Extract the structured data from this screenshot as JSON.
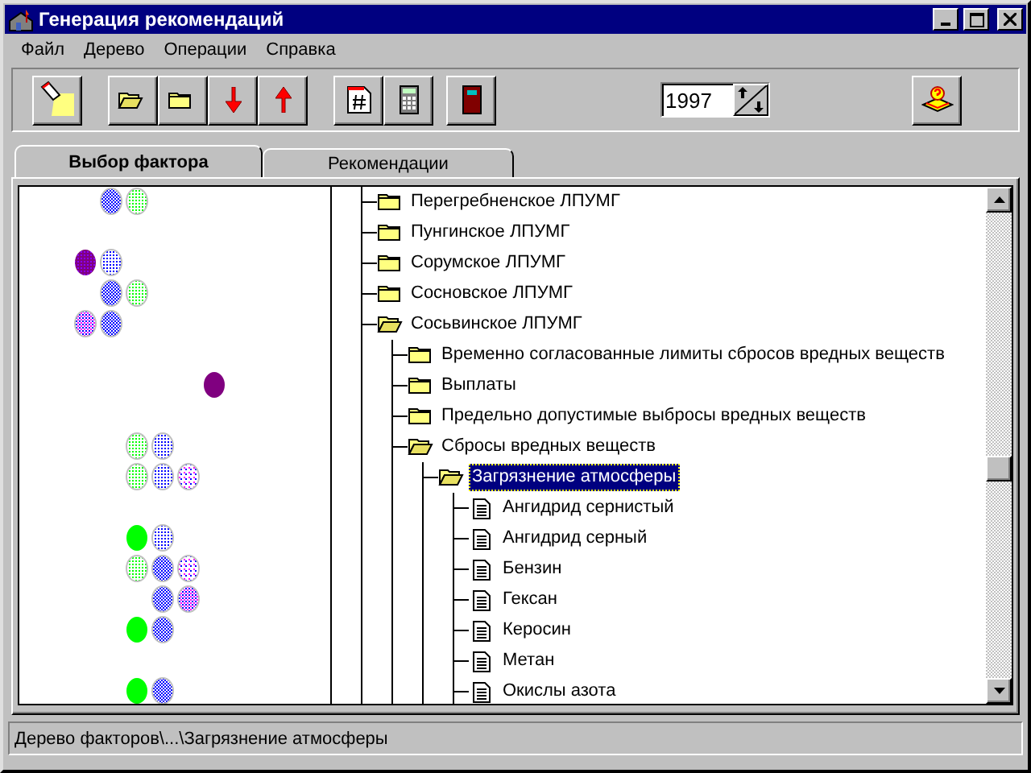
{
  "window": {
    "title": "Генерация рекомендаций"
  },
  "menu": [
    {
      "label": "Файл"
    },
    {
      "label": "Дерево"
    },
    {
      "label": "Операции"
    },
    {
      "label": "Справка"
    }
  ],
  "toolbar": {
    "year": "1997"
  },
  "tabs": [
    {
      "label": "Выбор фактора",
      "selected": true
    },
    {
      "label": "Рекомендации",
      "selected": false
    }
  ],
  "tree": [
    {
      "label": "Перегребненское ЛПУМГ",
      "kind": "folder",
      "expanded": false,
      "selected": false
    },
    {
      "label": "Пунгинское ЛПУМГ",
      "kind": "folder",
      "expanded": false,
      "selected": false
    },
    {
      "label": "Сорумское ЛПУМГ",
      "kind": "folder",
      "expanded": false,
      "selected": false
    },
    {
      "label": "Сосновское ЛПУМГ",
      "kind": "folder",
      "expanded": false,
      "selected": false
    },
    {
      "label": "Сосьвинское ЛПУМГ",
      "kind": "folder",
      "expanded": true,
      "selected": false,
      "children": [
        {
          "label": "Временно согласованные лимиты сбросов вредных веществ",
          "kind": "folder",
          "expanded": false,
          "selected": false
        },
        {
          "label": "Выплаты",
          "kind": "folder",
          "expanded": false,
          "selected": false
        },
        {
          "label": "Предельно допустимые выбросы вредных веществ",
          "kind": "folder",
          "expanded": false,
          "selected": false
        },
        {
          "label": "Сбросы вредных веществ",
          "kind": "folder",
          "expanded": true,
          "selected": false,
          "children": [
            {
              "label": "Загрязнение атмосферы",
              "kind": "folder",
              "expanded": true,
              "selected": true,
              "children": [
                {
                  "label": "Ангидрид сернистый",
                  "kind": "document",
                  "selected": false
                },
                {
                  "label": "Ангидрид серный",
                  "kind": "document",
                  "selected": false
                },
                {
                  "label": "Бензин",
                  "kind": "document",
                  "selected": false
                },
                {
                  "label": "Гексан",
                  "kind": "document",
                  "selected": false
                },
                {
                  "label": "Керосин",
                  "kind": "document",
                  "selected": false
                },
                {
                  "label": "Метан",
                  "kind": "document",
                  "selected": false
                },
                {
                  "label": "Окислы азота",
                  "kind": "document",
                  "selected": false
                }
              ]
            }
          ]
        }
      ]
    }
  ],
  "status_bar": "Дерево факторов\\...\\Загрязнение атмосферы"
}
